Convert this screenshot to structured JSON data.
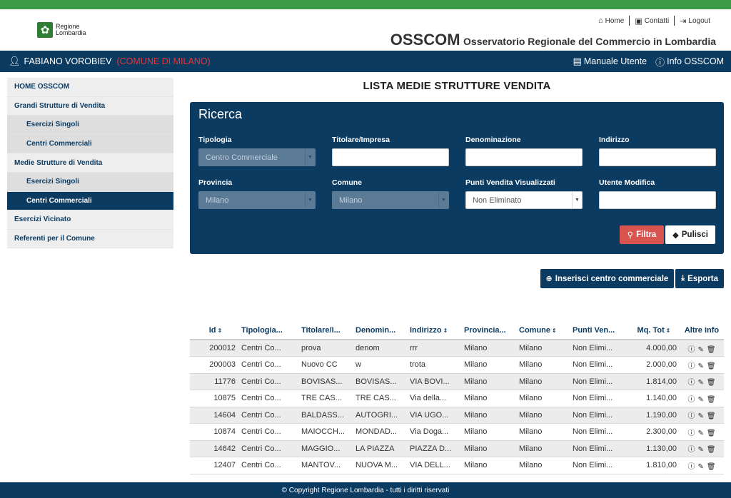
{
  "header": {
    "logo_line1": "Regione",
    "logo_line2": "Lombardia",
    "links": {
      "home": "Home",
      "contatti": "Contatti",
      "logout": "Logout"
    },
    "brand_short": "OSSCOM",
    "brand_long": "Osservatorio Regionale del Commercio in Lombardia"
  },
  "userbar": {
    "user_name": "FABIANO VOROBIEV",
    "comune": "(COMUNE DI MILANO)",
    "manuale": "Manuale Utente",
    "info": "Info OSSCOM"
  },
  "sidebar": {
    "items": [
      {
        "label": "HOME OSSCOM"
      },
      {
        "label": "Grandi Strutture di Vendita"
      },
      {
        "label": "Esercizi Singoli"
      },
      {
        "label": "Centri Commerciali"
      },
      {
        "label": "Medie Strutture di Vendita"
      },
      {
        "label": "Esercizi Singoli"
      },
      {
        "label": "Centri Commerciali"
      },
      {
        "label": "Esercizi Vicinato"
      },
      {
        "label": "Referenti per il Comune"
      }
    ]
  },
  "page": {
    "title": "LISTA MEDIE STRUTTURE VENDITA"
  },
  "search": {
    "title": "Ricerca",
    "tipologia": {
      "label": "Tipologia",
      "value": "Centro Commerciale"
    },
    "titolare": {
      "label": "Titolare/Impresa",
      "value": ""
    },
    "denominazione": {
      "label": "Denominazione",
      "value": ""
    },
    "indirizzo": {
      "label": "Indirizzo",
      "value": ""
    },
    "provincia": {
      "label": "Provincia",
      "value": "Milano"
    },
    "comune": {
      "label": "Comune",
      "value": "Milano"
    },
    "punti_vendita": {
      "label": "Punti Vendita Visualizzati",
      "value": "Non Eliminato"
    },
    "utente_modifica": {
      "label": "Utente Modifica",
      "value": ""
    },
    "filtra": "Filtra",
    "pulisci": "Pulisci"
  },
  "actions": {
    "inserisci": "Inserisci centro commerciale",
    "esporta": "Esporta"
  },
  "table": {
    "headers": {
      "id": "Id",
      "tipologia": "Tipologia...",
      "titolare": "Titolare/I...",
      "denominazione": "Denomin...",
      "indirizzo": "Indirizzo",
      "provincia": "Provincia...",
      "comune": "Comune",
      "punti": "Punti Ven...",
      "mq": "Mq. Tot",
      "altre": "Altre info"
    },
    "rows": [
      {
        "id": "200012",
        "tipologia": "Centri Co...",
        "titolare": "prova",
        "denominazione": "denom",
        "indirizzo": "rrr",
        "provincia": "Milano",
        "comune": "Milano",
        "punti": "Non Elimi...",
        "mq": "4.000,00"
      },
      {
        "id": "200003",
        "tipologia": "Centri Co...",
        "titolare": "Nuovo CC",
        "denominazione": "w",
        "indirizzo": "trota",
        "provincia": "Milano",
        "comune": "Milano",
        "punti": "Non Elimi...",
        "mq": "2.000,00"
      },
      {
        "id": "11776",
        "tipologia": "Centri Co...",
        "titolare": "BOVISAS...",
        "denominazione": "BOVISAS...",
        "indirizzo": "VIA BOVI...",
        "provincia": "Milano",
        "comune": "Milano",
        "punti": "Non Elimi...",
        "mq": "1.814,00"
      },
      {
        "id": "10875",
        "tipologia": "Centri Co...",
        "titolare": "TRE CAS...",
        "denominazione": "TRE CAS...",
        "indirizzo": "Via della...",
        "provincia": "Milano",
        "comune": "Milano",
        "punti": "Non Elimi...",
        "mq": "1.140,00"
      },
      {
        "id": "14604",
        "tipologia": "Centri Co...",
        "titolare": "BALDASS...",
        "denominazione": "AUTOGRI...",
        "indirizzo": "VIA UGO...",
        "provincia": "Milano",
        "comune": "Milano",
        "punti": "Non Elimi...",
        "mq": "1.190,00"
      },
      {
        "id": "10874",
        "tipologia": "Centri Co...",
        "titolare": "MAIOCCH...",
        "denominazione": "MONDAD...",
        "indirizzo": "Via Doga...",
        "provincia": "Milano",
        "comune": "Milano",
        "punti": "Non Elimi...",
        "mq": "2.300,00"
      },
      {
        "id": "14642",
        "tipologia": "Centri Co...",
        "titolare": "MAGGIO...",
        "denominazione": "LA PIAZZA",
        "indirizzo": "PIAZZA D...",
        "provincia": "Milano",
        "comune": "Milano",
        "punti": "Non Elimi...",
        "mq": "1.130,00"
      },
      {
        "id": "12407",
        "tipologia": "Centri Co...",
        "titolare": "MANTOV...",
        "denominazione": "NUOVA M...",
        "indirizzo": "VIA DELL...",
        "provincia": "Milano",
        "comune": "Milano",
        "punti": "Non Elimi...",
        "mq": "1.810,00"
      }
    ]
  },
  "footer": {
    "text": "© Copyright Regione Lombardia - tutti i diritti riservati"
  },
  "colors": {
    "green": "#3d9a46",
    "navy": "#0c3b62",
    "red": "#d9534f",
    "alert_red": "#e8333b"
  }
}
